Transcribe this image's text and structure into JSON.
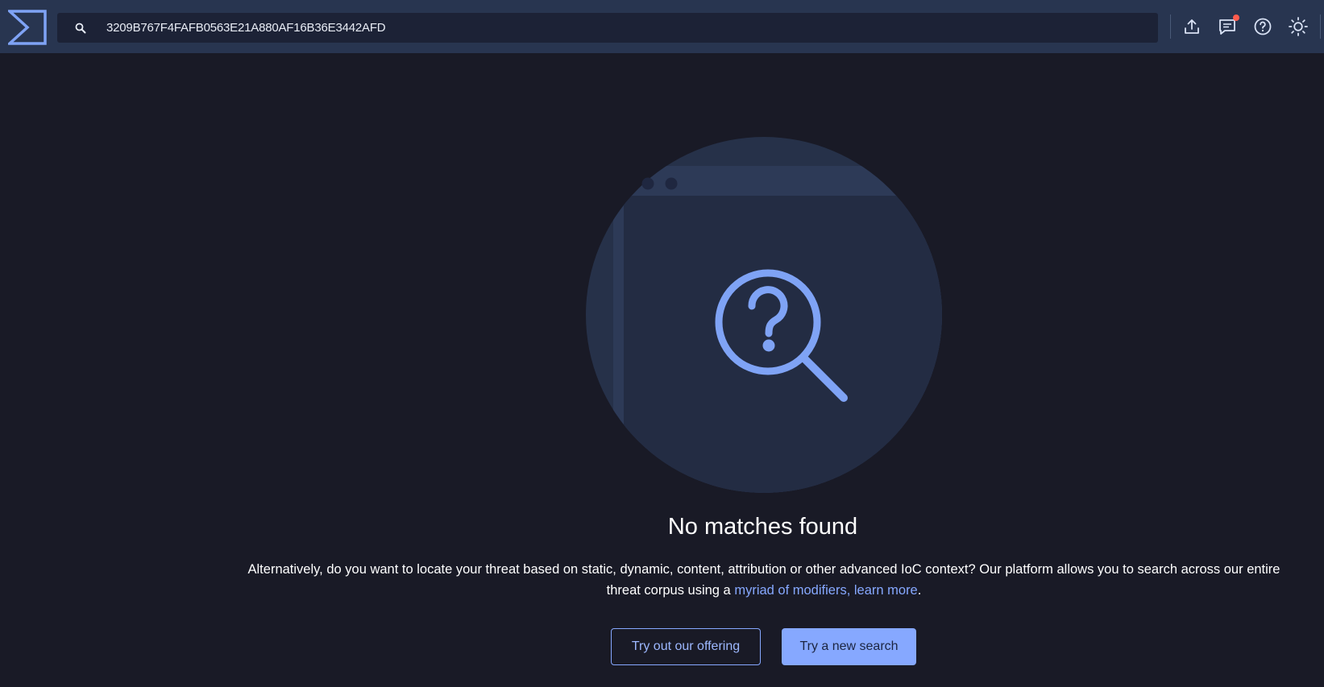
{
  "header": {
    "logo": "sigma-logo",
    "search": {
      "icon": "search-icon",
      "value": "3209B767F4FAFB0563E21A880AF16B36E3442AFD"
    },
    "actions": [
      {
        "icon": "upload-icon"
      },
      {
        "icon": "feedback-chat-icon",
        "has_notification": true
      },
      {
        "icon": "help-icon"
      },
      {
        "icon": "theme-sun-icon"
      }
    ]
  },
  "empty_state": {
    "illustration": "magnifier-question-icon",
    "title": "No matches found",
    "description_before": "Alternatively, do you want to locate your threat based on static, dynamic, content, attribution or other advanced IoC context? Our platform allows you to search across our entire threat corpus using a ",
    "description_link": "myriad of modifiers, learn more",
    "description_after": ".",
    "secondary_button": "Try out our offering",
    "primary_button": "Try a new search"
  },
  "colors": {
    "background": "#191a26",
    "topbar": "#283550",
    "accent": "#86a8ff",
    "notification": "#ff5b4d"
  }
}
